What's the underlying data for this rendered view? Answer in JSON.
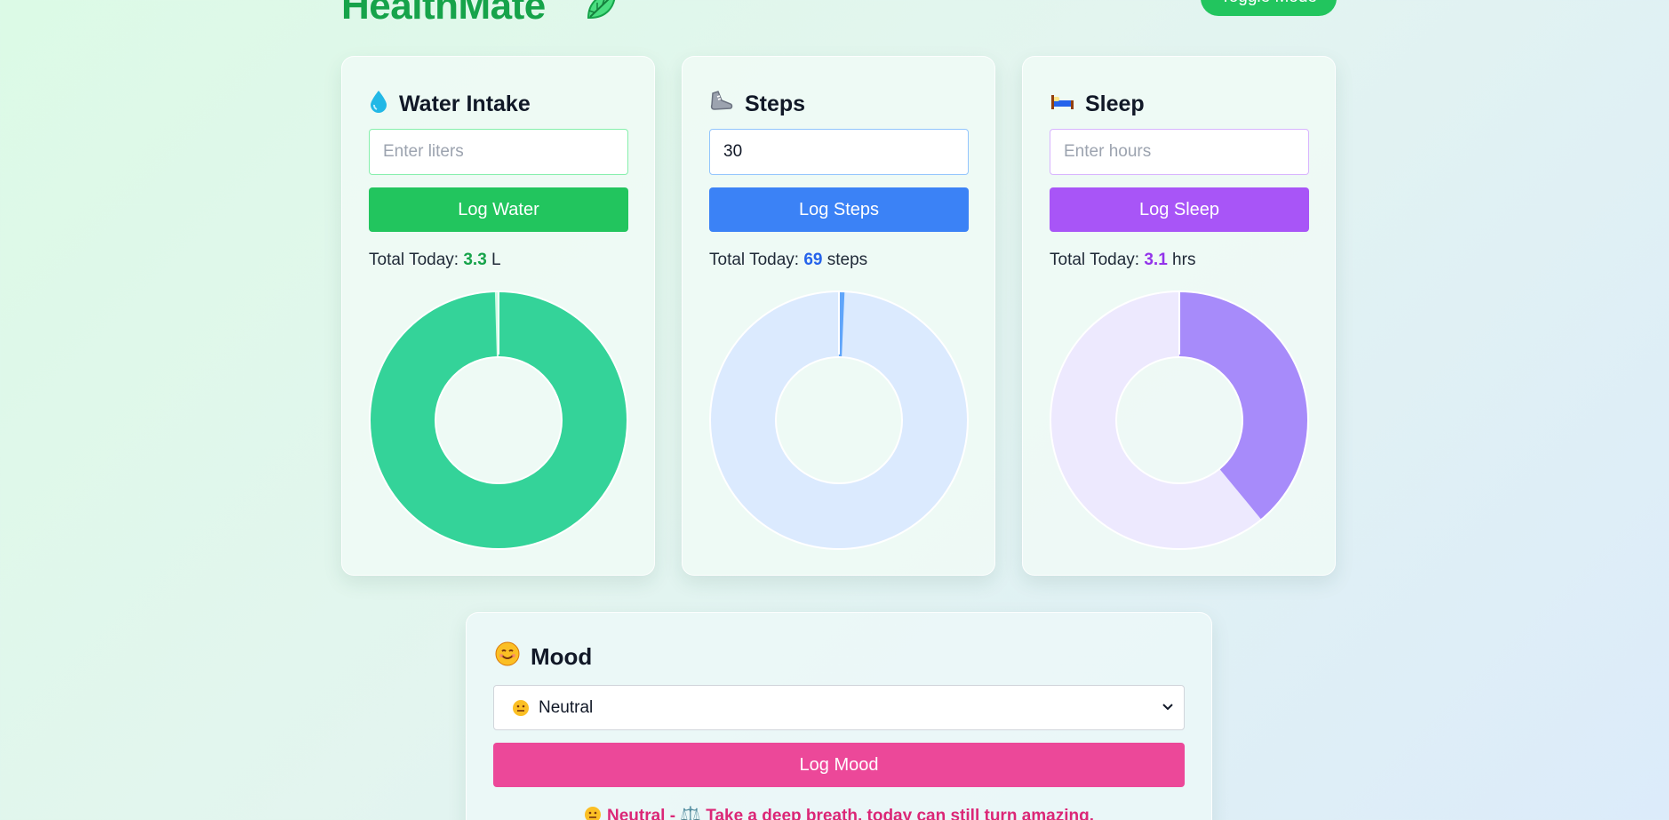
{
  "header": {
    "brand": "HealthMate",
    "toggle_label": "Toggle Mode",
    "leaf_icon": "leaf-icon"
  },
  "colors": {
    "water": "#22c55e",
    "steps": "#3b82f6",
    "sleep": "#a855f7",
    "mood": "#ec4899"
  },
  "cards": {
    "water": {
      "title": "Water Intake",
      "icon": "droplet-icon",
      "input_value": "",
      "placeholder": "Enter liters",
      "button": "Log Water",
      "total_prefix": "Total Today:",
      "total_value": "3.3",
      "total_unit": "L",
      "progress": 0.995
    },
    "steps": {
      "title": "Steps",
      "icon": "sneaker-icon",
      "input_value": "30",
      "placeholder": "",
      "button": "Log Steps",
      "total_prefix": "Total Today:",
      "total_value": "69",
      "total_unit": "steps",
      "progress": 0.007
    },
    "sleep": {
      "title": "Sleep",
      "icon": "bed-icon",
      "input_value": "",
      "placeholder": "Enter hours",
      "button": "Log Sleep",
      "total_prefix": "Total Today:",
      "total_value": "3.1",
      "total_unit": "hrs",
      "progress": 0.39
    }
  },
  "mood": {
    "title": "Mood",
    "icon": "smiling-face-icon",
    "selected": "Neutral",
    "button": "Log Mood",
    "message": "Neutral - ⚖️ Take a deep breath, today can still turn amazing."
  }
}
